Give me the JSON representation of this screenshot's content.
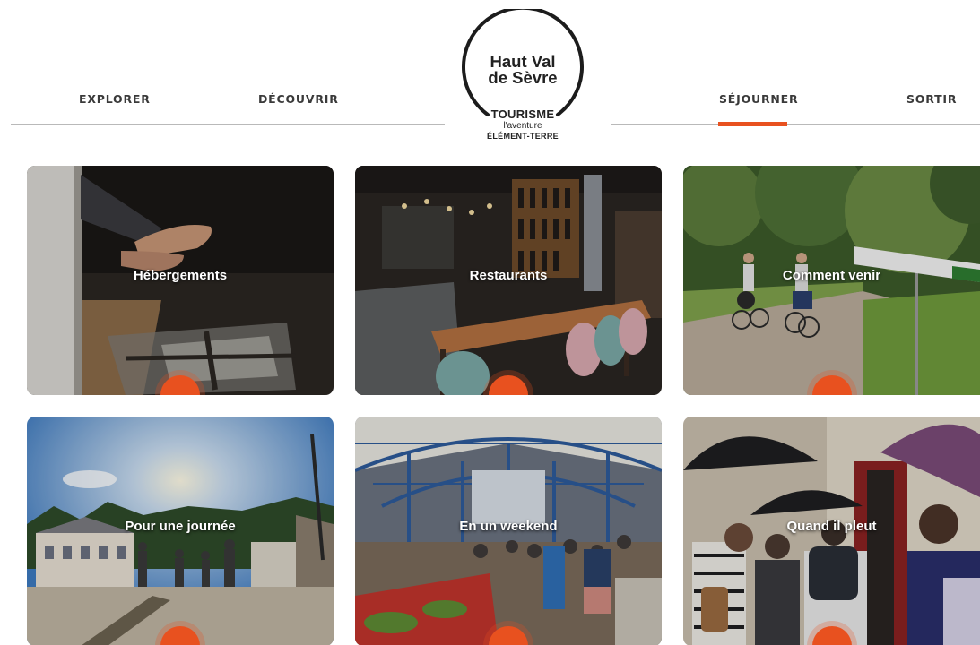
{
  "nav": {
    "left": [
      "EXPLORER",
      "DÉCOUVRIR"
    ],
    "right": [
      "SÉJOURNER",
      "SORTIR"
    ],
    "active": "SÉJOURNER"
  },
  "logo": {
    "line1": "Haut Val",
    "line2": "de Sèvre",
    "tourisme": "TOURISME",
    "tagline1": "l'aventure",
    "tagline2": "ÉLÉMENT-TERRE"
  },
  "cards": [
    {
      "label": "Hébergements",
      "icon": "photo-bare-feet-sunlight"
    },
    {
      "label": "Restaurants",
      "icon": "photo-wine-bar"
    },
    {
      "label": "Comment venir",
      "icon": "photo-cyclists-road"
    },
    {
      "label": "Pour une journée",
      "icon": "photo-family-sunny-street"
    },
    {
      "label": "En un weekend",
      "icon": "photo-covered-market"
    },
    {
      "label": "Quand il pleut",
      "icon": "photo-umbrellas-rain"
    }
  ],
  "colors": {
    "accent": "#e8511f",
    "nav_text": "#3a3a3a",
    "divider": "#b9b9b9"
  }
}
